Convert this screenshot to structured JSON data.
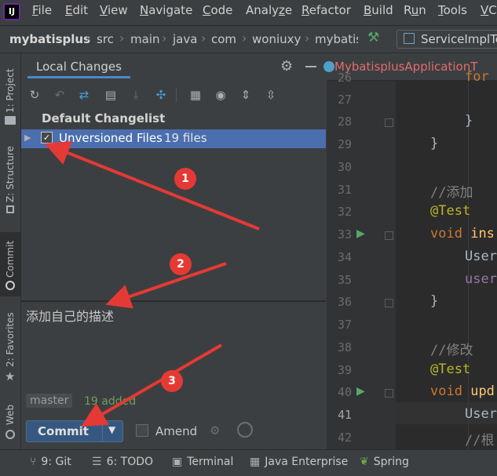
{
  "menubar": {
    "items": [
      {
        "label": "File",
        "mnemonic": "F"
      },
      {
        "label": "Edit",
        "mnemonic": "E"
      },
      {
        "label": "View",
        "mnemonic": "V"
      },
      {
        "label": "Navigate",
        "mnemonic": "N"
      },
      {
        "label": "Code",
        "mnemonic": "C"
      },
      {
        "label": "Analyze",
        "mnemonic": "z"
      },
      {
        "label": "Refactor",
        "mnemonic": "R"
      },
      {
        "label": "Build",
        "mnemonic": "B"
      },
      {
        "label": "Run",
        "mnemonic": "u"
      },
      {
        "label": "Tools",
        "mnemonic": "T"
      },
      {
        "label": "VC",
        "mnemonic": "V"
      }
    ]
  },
  "breadcrumb": {
    "items": [
      "mybatisplus",
      "src",
      "main",
      "java",
      "com",
      "woniuxy",
      "mybatis"
    ],
    "run_config": "ServiceImplTe"
  },
  "left_strip": {
    "project": "1: Project",
    "structure": "Z: Structure",
    "commit": "Commit",
    "favorites": "2: Favorites",
    "web": "Web"
  },
  "local_changes": {
    "tab": "Local Changes",
    "changelist_title": "Default Changelist",
    "unversioned_label": "Unversioned Files",
    "unversioned_count": "19 files",
    "commit_message": "添加自己的描述",
    "branch": "master",
    "added_status": "19 added",
    "commit_label": "Commit",
    "amend_label": "Amend"
  },
  "editor": {
    "tab_title": "MybatisplusApplicationT",
    "line_numbers": [
      "26",
      "27",
      "28",
      "29",
      "30",
      "31",
      "32",
      "33",
      "34",
      "35",
      "36",
      "37",
      "38",
      "39",
      "40",
      "41",
      "42"
    ],
    "code": {
      "l26": "for",
      "l28": "}",
      "l29": "}",
      "l31": "//添加",
      "l32": "@Test",
      "l33_kw": "void",
      "l33_fn": "ins",
      "l34": "User",
      "l35": "user",
      "l36": "}",
      "l38": "//修改",
      "l39": "@Test",
      "l40_kw": "void",
      "l40_fn": "upd",
      "l41": "User",
      "l42": "//根"
    }
  },
  "bottom_bar": {
    "git": "9: Git",
    "todo": "6: TODO",
    "terminal": "Terminal",
    "java_enterprise": "Java Enterprise",
    "spring": "Spring"
  },
  "annotations": {
    "badge1": "1",
    "badge2": "2",
    "badge3": "3",
    "arrow_color": "#e53935"
  }
}
